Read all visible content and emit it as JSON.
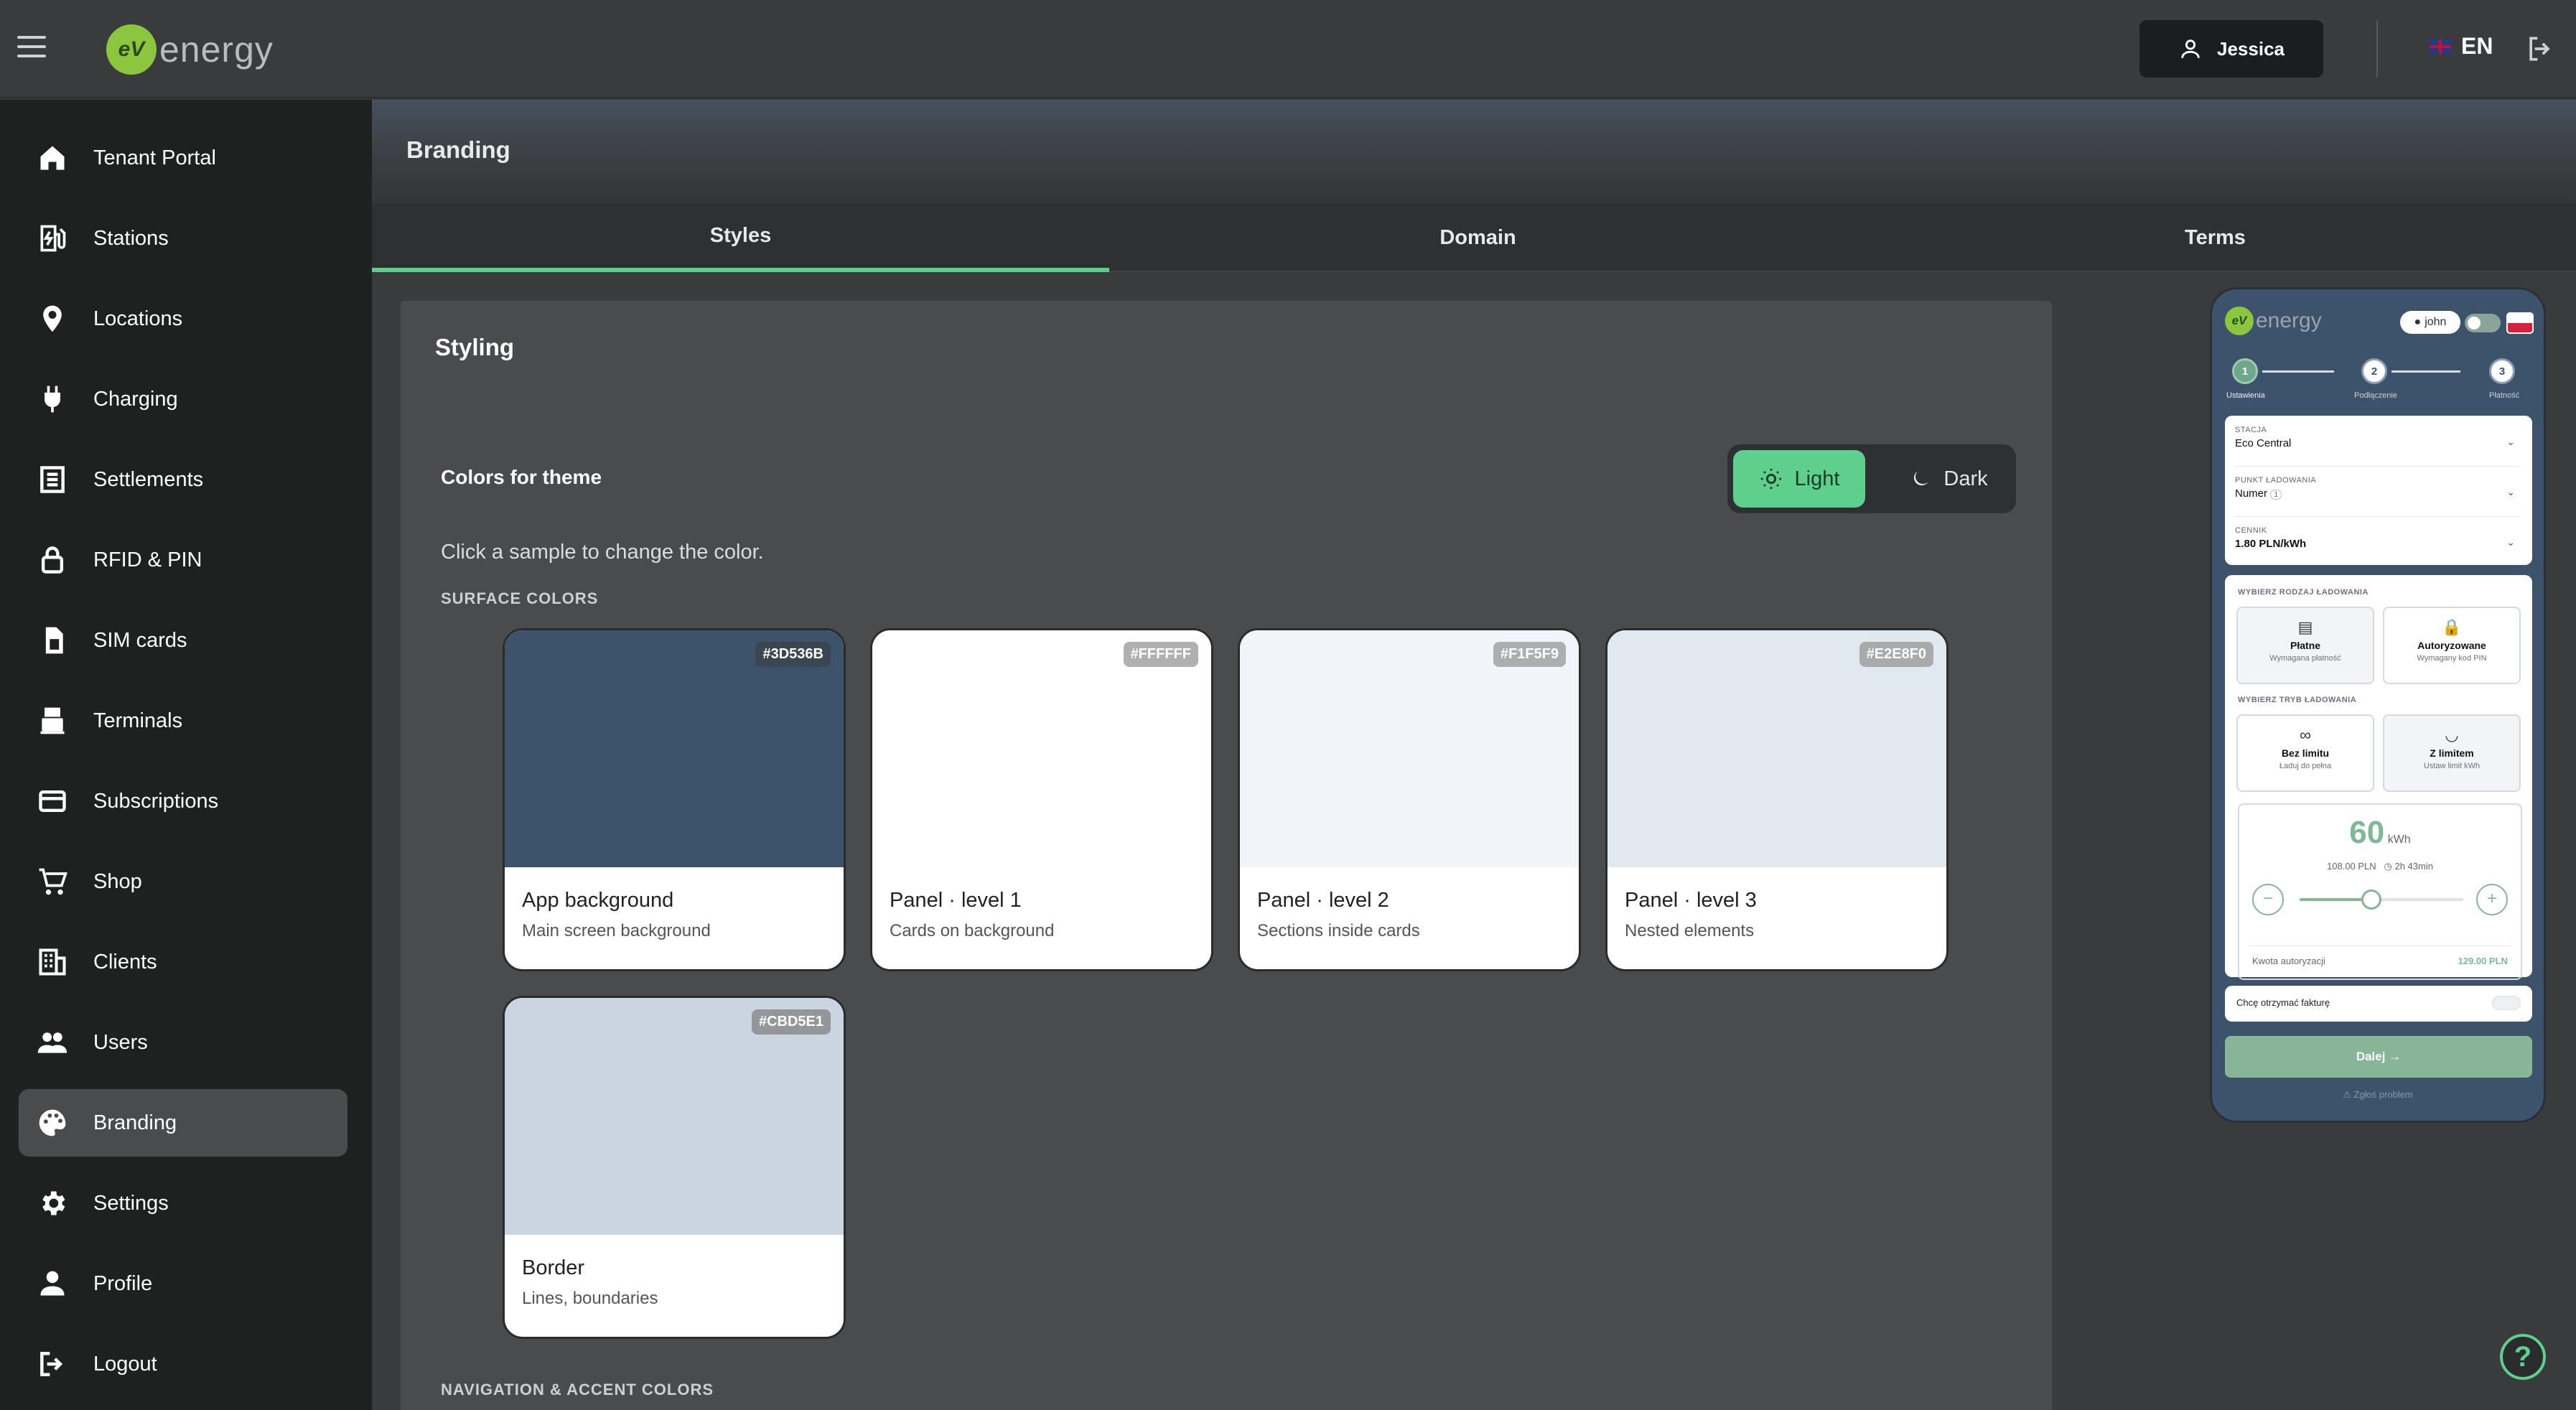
{
  "app": {
    "logo_badge": "eV",
    "logo_text": "energy",
    "user_name": "Jessica",
    "language": "EN"
  },
  "sidebar": {
    "items": [
      {
        "label": "Tenant Portal",
        "icon": "home-icon"
      },
      {
        "label": "Stations",
        "icon": "ev-station-icon"
      },
      {
        "label": "Locations",
        "icon": "location-pin-icon"
      },
      {
        "label": "Charging",
        "icon": "plug-icon"
      },
      {
        "label": "Settlements",
        "icon": "receipt-icon"
      },
      {
        "label": "RFID & PIN",
        "icon": "lock-icon"
      },
      {
        "label": "SIM cards",
        "icon": "sim-card-icon"
      },
      {
        "label": "Terminals",
        "icon": "terminal-icon"
      },
      {
        "label": "Subscriptions",
        "icon": "card-icon"
      },
      {
        "label": "Shop",
        "icon": "cart-icon"
      },
      {
        "label": "Clients",
        "icon": "building-icon"
      },
      {
        "label": "Users",
        "icon": "users-icon"
      },
      {
        "label": "Branding",
        "icon": "palette-icon"
      },
      {
        "label": "Settings",
        "icon": "gear-icon"
      },
      {
        "label": "Profile",
        "icon": "person-icon"
      },
      {
        "label": "Logout",
        "icon": "logout-icon"
      }
    ],
    "active": "Branding"
  },
  "page": {
    "title": "Branding"
  },
  "tabs": [
    {
      "label": "Styles",
      "active": true
    },
    {
      "label": "Domain"
    },
    {
      "label": "Terms"
    }
  ],
  "styling": {
    "title": "Styling",
    "colors_label": "Colors for theme",
    "theme_light": "Light",
    "theme_dark": "Dark",
    "selected_theme": "Light",
    "hint": "Click a sample to change the color.",
    "surface_section": "SURFACE COLORS",
    "nav_section": "NAVIGATION & ACCENT COLORS",
    "swatches": [
      {
        "hex": "#3D536B",
        "name": "App background",
        "desc": "Main screen background"
      },
      {
        "hex": "#FFFFFF",
        "name": "Panel · level 1",
        "desc": "Cards on background"
      },
      {
        "hex": "#F1F5F9",
        "name": "Panel · level 2",
        "desc": "Sections inside cards"
      },
      {
        "hex": "#E2E8F0",
        "name": "Panel · level 3",
        "desc": "Nested elements"
      },
      {
        "hex": "#CBD5E1",
        "name": "Border",
        "desc": "Lines, boundaries"
      }
    ]
  },
  "preview": {
    "logo_badge": "eV",
    "logo_text": "energy",
    "user": "john",
    "steps": [
      {
        "num": "1",
        "label": "Ustawienia"
      },
      {
        "num": "2",
        "label": "Podłączenie"
      },
      {
        "num": "3",
        "label": "Płatność"
      }
    ],
    "fields": [
      {
        "label": "STACJA",
        "value": "Eco Central"
      },
      {
        "label": "PUNKT ŁADOWANIA",
        "value": "Numer",
        "badge": "1"
      },
      {
        "label": "CENNIK",
        "value": "1.80 PLN/kWh"
      }
    ],
    "charge_type_label": "WYBIERZ RODZAJ ŁADOWANIA",
    "charge_types": [
      {
        "title": "Płatne",
        "sub": "Wymagana płatność"
      },
      {
        "title": "Autoryzowane",
        "sub": "Wymagany kod PIN"
      }
    ],
    "charge_mode_label": "WYBIERZ TRYB ŁADOWANIA",
    "charge_modes": [
      {
        "title": "Bez limitu",
        "sub": "Ładuj do pełna"
      },
      {
        "title": "Z limitem",
        "sub": "Ustaw limit kWh"
      }
    ],
    "kwh_value": "60",
    "kwh_unit": "kWh",
    "price": "108.00 PLN",
    "time": "2h 43min",
    "slider_fraction": 0.44,
    "auth_label": "Kwota autoryzacji",
    "auth_value": "129.00 PLN",
    "invoice_label": "Chcę otrzymać fakturę",
    "next_label": "Dalej →",
    "report_label": "⚠ Zgłoś problem"
  },
  "colors": {
    "accent": "#5fcf8d",
    "sidebar_bg": "#1e2120",
    "topbar_bg": "#3a3b3d"
  }
}
